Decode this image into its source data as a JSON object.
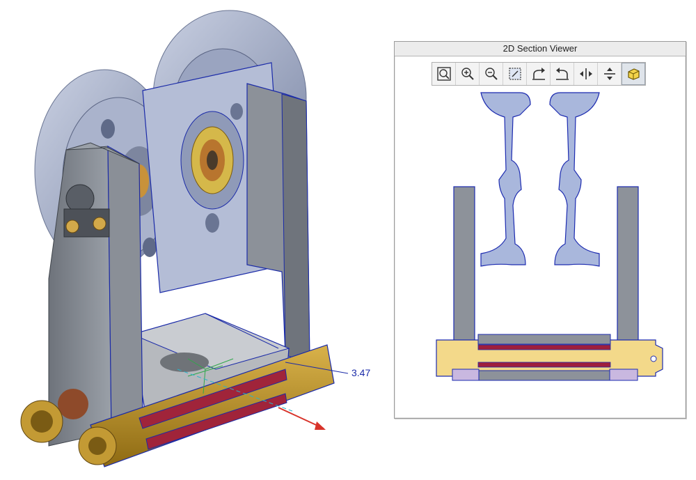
{
  "viewport": {
    "dimension_value": "3.47",
    "colors": {
      "wheel": "#9fa9c4",
      "frame": "#8f949c",
      "base": "#b6b9be",
      "brass": "#c49a2a",
      "edge": "#1a2aa8",
      "red_strip": "#a0243a"
    }
  },
  "section_viewer": {
    "title": "2D Section Viewer",
    "toolbar": [
      {
        "name": "zoom-fit-icon"
      },
      {
        "name": "zoom-in-icon"
      },
      {
        "name": "zoom-out-icon"
      },
      {
        "name": "zoom-window-icon"
      },
      {
        "name": "rotate-cw-icon"
      },
      {
        "name": "rotate-ccw-icon"
      },
      {
        "name": "flip-horizontal-icon"
      },
      {
        "name": "flip-vertical-icon"
      },
      {
        "name": "shaded-view-icon",
        "active": true
      }
    ],
    "colors": {
      "wheel": "#a9b7dc",
      "frame": "#8d929a",
      "brass": "#f3d98a",
      "strip": "#9e1f3c",
      "edge": "#1c2bb0"
    }
  }
}
